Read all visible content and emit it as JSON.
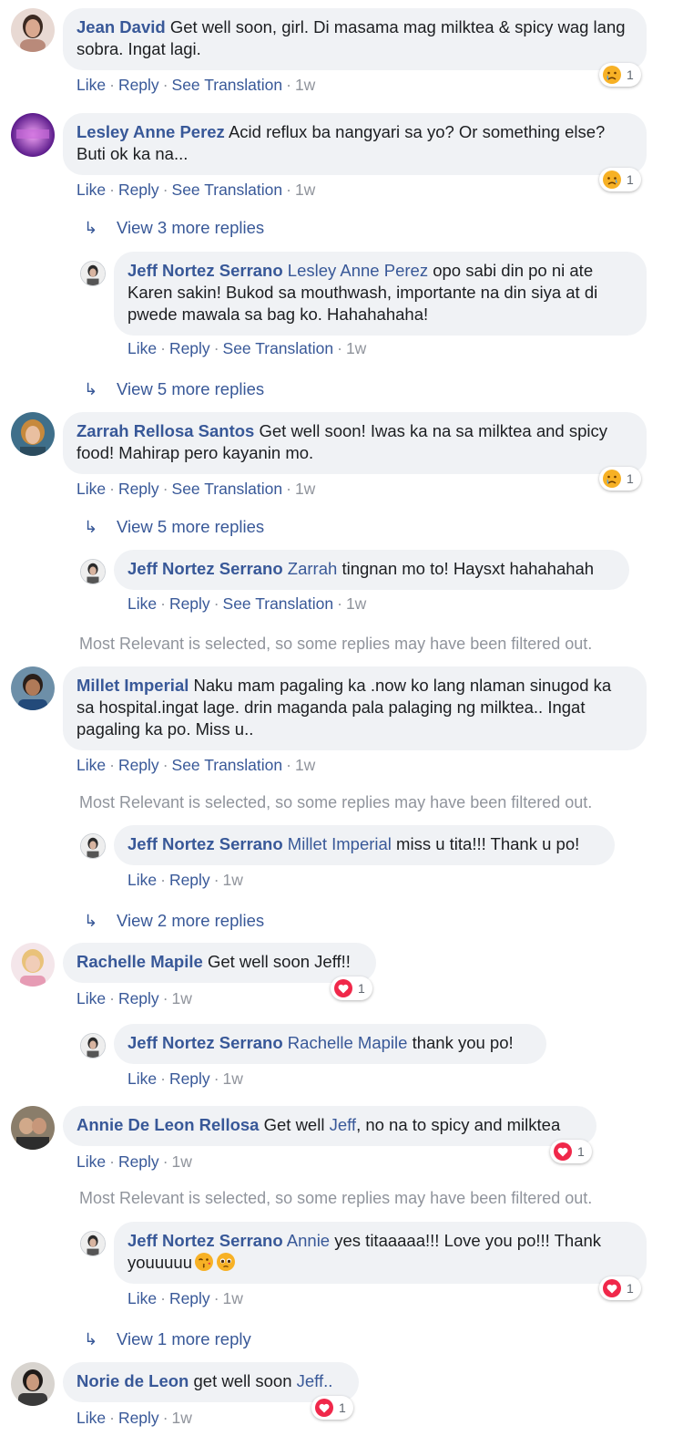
{
  "colors": {
    "link": "#385898",
    "bubble": "#f0f2f5",
    "meta": "#90949c",
    "heart": "#f0284a",
    "sad": "#f7b125"
  },
  "common": {
    "like": "Like",
    "reply": "Reply",
    "see_translation": "See Translation",
    "dot": "·"
  },
  "filtered_notice": "Most Relevant is selected, so some replies may have been filtered out.",
  "comments": [
    {
      "author": "Jean David",
      "text": "Get well soon, girl. Di masama mag milktea & spicy wag lang sobra. Ingat lagi.",
      "time": "1w",
      "reaction": {
        "icon": "crying-face-icon",
        "count": "1"
      }
    },
    {
      "author": "Lesley Anne Perez",
      "text": "Acid reflux ba nangyari sa yo? Or something else? Buti ok ka na...",
      "time": "1w",
      "reaction": {
        "icon": "sad-face-icon",
        "count": "1"
      },
      "view_more": "View 3 more replies",
      "reply": {
        "author": "Jeff Nortez Serrano",
        "mention": "Lesley Anne Perez",
        "text": "opo sabi din po ni ate Karen sakin! Bukod sa mouthwash, importante na din siya at di pwede mawala sa bag ko. Hahahahaha!",
        "time": "1w"
      },
      "view_more_after": "View 5 more replies"
    },
    {
      "author": "Zarrah Rellosa Santos",
      "text": "Get well soon! Iwas ka na sa milktea and spicy food! Mahirap pero kayanin mo.",
      "time": "1w",
      "reaction": {
        "icon": "crying-face-icon",
        "count": "1"
      },
      "view_more": "View 5 more replies",
      "reply": {
        "author": "Jeff Nortez Serrano",
        "mention": "Zarrah",
        "text": "tingnan mo to! Haysxt hahahahah",
        "time": "1w"
      }
    },
    {
      "author": "Millet Imperial",
      "text": "Naku mam pagaling ka .now ko lang nlaman sinugod ka sa hospital.ingat lage. drin maganda pala palaging ng milktea.. Ingat pagaling ka po. Miss u..",
      "time": "1w",
      "reply": {
        "author": "Jeff Nortez Serrano",
        "mention": "Millet Imperial",
        "text": "miss u tita!!! Thank u po!",
        "time": "1w"
      },
      "view_more_after": "View 2 more replies"
    },
    {
      "author": "Rachelle Mapile",
      "text": "Get well soon Jeff!!",
      "time": "1w",
      "reaction": {
        "icon": "heart-icon",
        "count": "1"
      },
      "reply": {
        "author": "Jeff Nortez Serrano",
        "mention": "Rachelle Mapile",
        "text": "thank you po!",
        "time": "1w"
      }
    },
    {
      "author": "Annie De Leon Rellosa",
      "text_before": "Get well",
      "mention": "Jeff",
      "text": ", no na to spicy and milktea",
      "time": "1w",
      "reaction": {
        "icon": "heart-icon",
        "count": "1"
      },
      "reply": {
        "author": "Jeff Nortez Serrano",
        "mention": "Annie",
        "text": "yes titaaaaa!!! Love you po!!! Thank youuuuu",
        "emoji": [
          "kiss-face-icon",
          "pleading-face-icon"
        ],
        "time": "1w",
        "reaction": {
          "icon": "heart-icon",
          "count": "1"
        }
      },
      "view_more_after": "View 1 more reply"
    },
    {
      "author": "Norie de Leon",
      "text_before": "get well soon",
      "mention": "Jeff..",
      "time": "1w",
      "reaction": {
        "icon": "heart-icon",
        "count": "1"
      }
    }
  ]
}
